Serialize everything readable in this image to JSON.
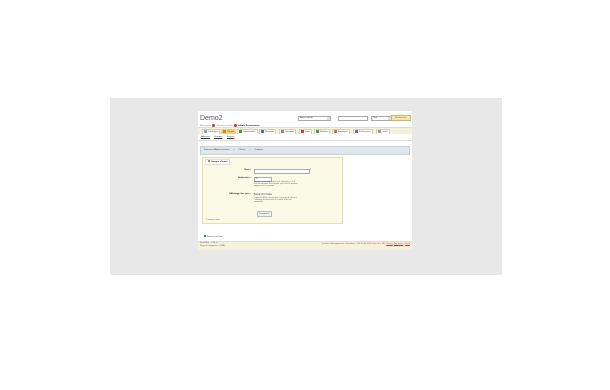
{
  "app": {
    "title": "Demo2",
    "user_line": {
      "prefix": "Bienvenue",
      "separator": "Fermer session",
      "employee": "Alexis Dessermann"
    }
  },
  "header": {
    "select_access": "Accès rapide",
    "select_scope": "Tout",
    "search_button": "Rechercher"
  },
  "nav": {
    "tabs": [
      {
        "label": "Catalogue",
        "icon": "catalog-icon",
        "color": "#7a9fd6"
      },
      {
        "label": "Clients",
        "icon": "clients-icon",
        "color": "#d9842b",
        "active": true
      },
      {
        "label": "Commandes",
        "icon": "orders-icon",
        "color": "#4f8f3f"
      },
      {
        "label": "Paiement",
        "icon": "payment-icon",
        "color": "#3d77c9"
      },
      {
        "label": "Transport",
        "icon": "transport-icon",
        "color": "#888888"
      },
      {
        "label": "Stats",
        "icon": "stats-icon",
        "color": "#c94040"
      },
      {
        "label": "Modules",
        "icon": "modules-icon",
        "color": "#4a9e4a"
      },
      {
        "label": "Employés",
        "icon": "employees-icon",
        "color": "#c97a2d"
      },
      {
        "label": "Préférences",
        "icon": "preferences-icon",
        "color": "#6a6aa8"
      },
      {
        "label": "Outils",
        "icon": "tools-icon",
        "color": "#9a9a9a"
      }
    ],
    "subtabs": [
      "Adresses",
      "Groupes",
      "Paniers"
    ]
  },
  "breadcrumb": {
    "root": "Panneau d'Administration",
    "level1": "Clients",
    "level2": "Groupes"
  },
  "form": {
    "panel_title": "Groupe clients",
    "name_label": "Nom :",
    "name_required": "*",
    "discount_label": "Réduction :",
    "discount_value": "0",
    "discount_hint": "Applique automatiquement cette réduction, en % à tous les membres de ce groupe, pour tous les produits appartenant à ce groupe",
    "price_label": "Affichage des prix :",
    "price_value": "taxe incluse",
    "price_hint": "Comment afficher les prix pour le groupe de clients à l'affichage du contenu de leur panier et de leur commande",
    "submit": "Enregistrer",
    "required_note": "* Champs requis"
  },
  "back_link": "Retour à la liste",
  "footer": {
    "version": "PrestaShop™ 1.4.0.17",
    "load_time": "Temps de chargement : 0.288s",
    "right_text": "Questions / Renseignements / Formations : +33 (0)1.40.18.30.04 de 09h à 18h",
    "contact": "Contact",
    "bug": "Bug-Tracker",
    "forum": "Forum"
  }
}
